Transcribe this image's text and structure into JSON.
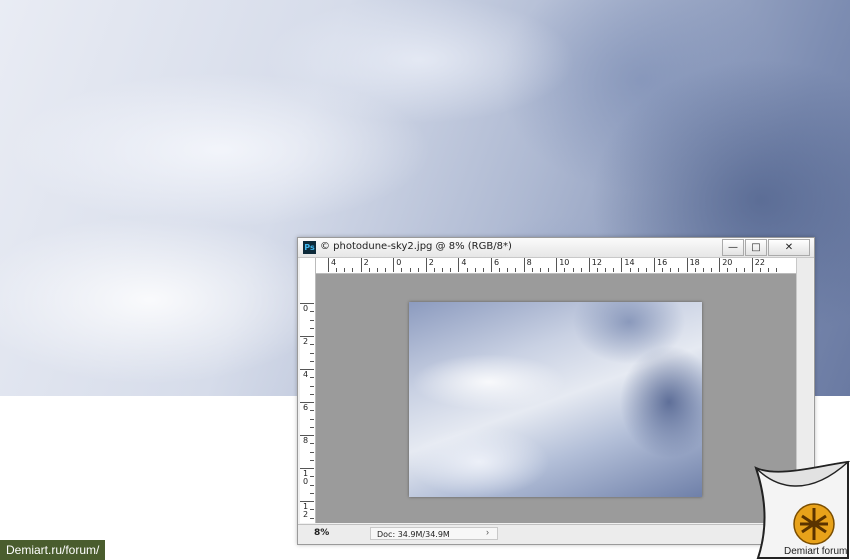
{
  "window": {
    "app_icon": "Ps",
    "title": "© photodune-sky2.jpg @ 8% (RGB/8*)",
    "buttons": {
      "minimize": "—",
      "maximize": "□",
      "close": "✕"
    }
  },
  "rulers": {
    "top_labels": [
      "4",
      "2",
      "0",
      "2",
      "4",
      "6",
      "8",
      "10",
      "12",
      "14",
      "16",
      "18",
      "20",
      "22"
    ],
    "left_labels": [
      "0",
      "2",
      "4",
      "6",
      "8",
      "1\n0",
      "1\n2"
    ]
  },
  "status": {
    "zoom": "8%",
    "doc": "Doc: 34.9M/34.9M",
    "arrow": "›"
  },
  "watermark": {
    "site": "Demiart.ru/forum/",
    "forum_label": "Demiart forum"
  },
  "colors": {
    "badge_bg": "#4a5d2e",
    "canvas_bg": "#9b9b9b",
    "logo_gold": "#e8a21a"
  }
}
